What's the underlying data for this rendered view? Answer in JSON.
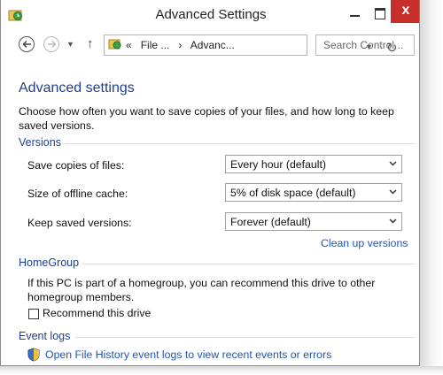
{
  "window": {
    "title": "Advanced Settings",
    "close_glyph": "x",
    "icons": {
      "app": "history-icon",
      "minimize": "minimize-icon",
      "maximize": "maximize-icon",
      "close": "close-icon"
    }
  },
  "navbar": {
    "breadcrumb_prefix": "«",
    "crumb1": "File ...",
    "separator": "›",
    "crumb2": "Advanc...",
    "search_placeholder": "Search Control...",
    "icons": [
      "back-icon",
      "forward-icon",
      "recent-locations-icon",
      "up-icon",
      "refresh-icon",
      "search-icon"
    ]
  },
  "main": {
    "heading": "Advanced settings",
    "description": "Choose how often you want to save copies of your files, and how long to keep saved versions."
  },
  "versions": {
    "group_label": "Versions",
    "save_copies": {
      "label": "Save copies of files:",
      "value": "Every hour (default)"
    },
    "offline_cache": {
      "label": "Size of offline cache:",
      "value": "5% of disk space (default)"
    },
    "keep_versions": {
      "label": "Keep saved versions:",
      "value": "Forever (default)"
    },
    "cleanup_link": "Clean up versions"
  },
  "homegroup": {
    "group_label": "HomeGroup",
    "text": "If this PC is part of a homegroup, you can recommend this drive to other homegroup members.",
    "checkbox_label": "Recommend this drive",
    "checkbox_checked": false
  },
  "event_logs": {
    "group_label": "Event logs",
    "link": "Open File History event logs to view recent events or errors"
  },
  "colors": {
    "accent": "#1e3f8f",
    "link": "#1e56b8",
    "close_button": "#c7302a"
  }
}
